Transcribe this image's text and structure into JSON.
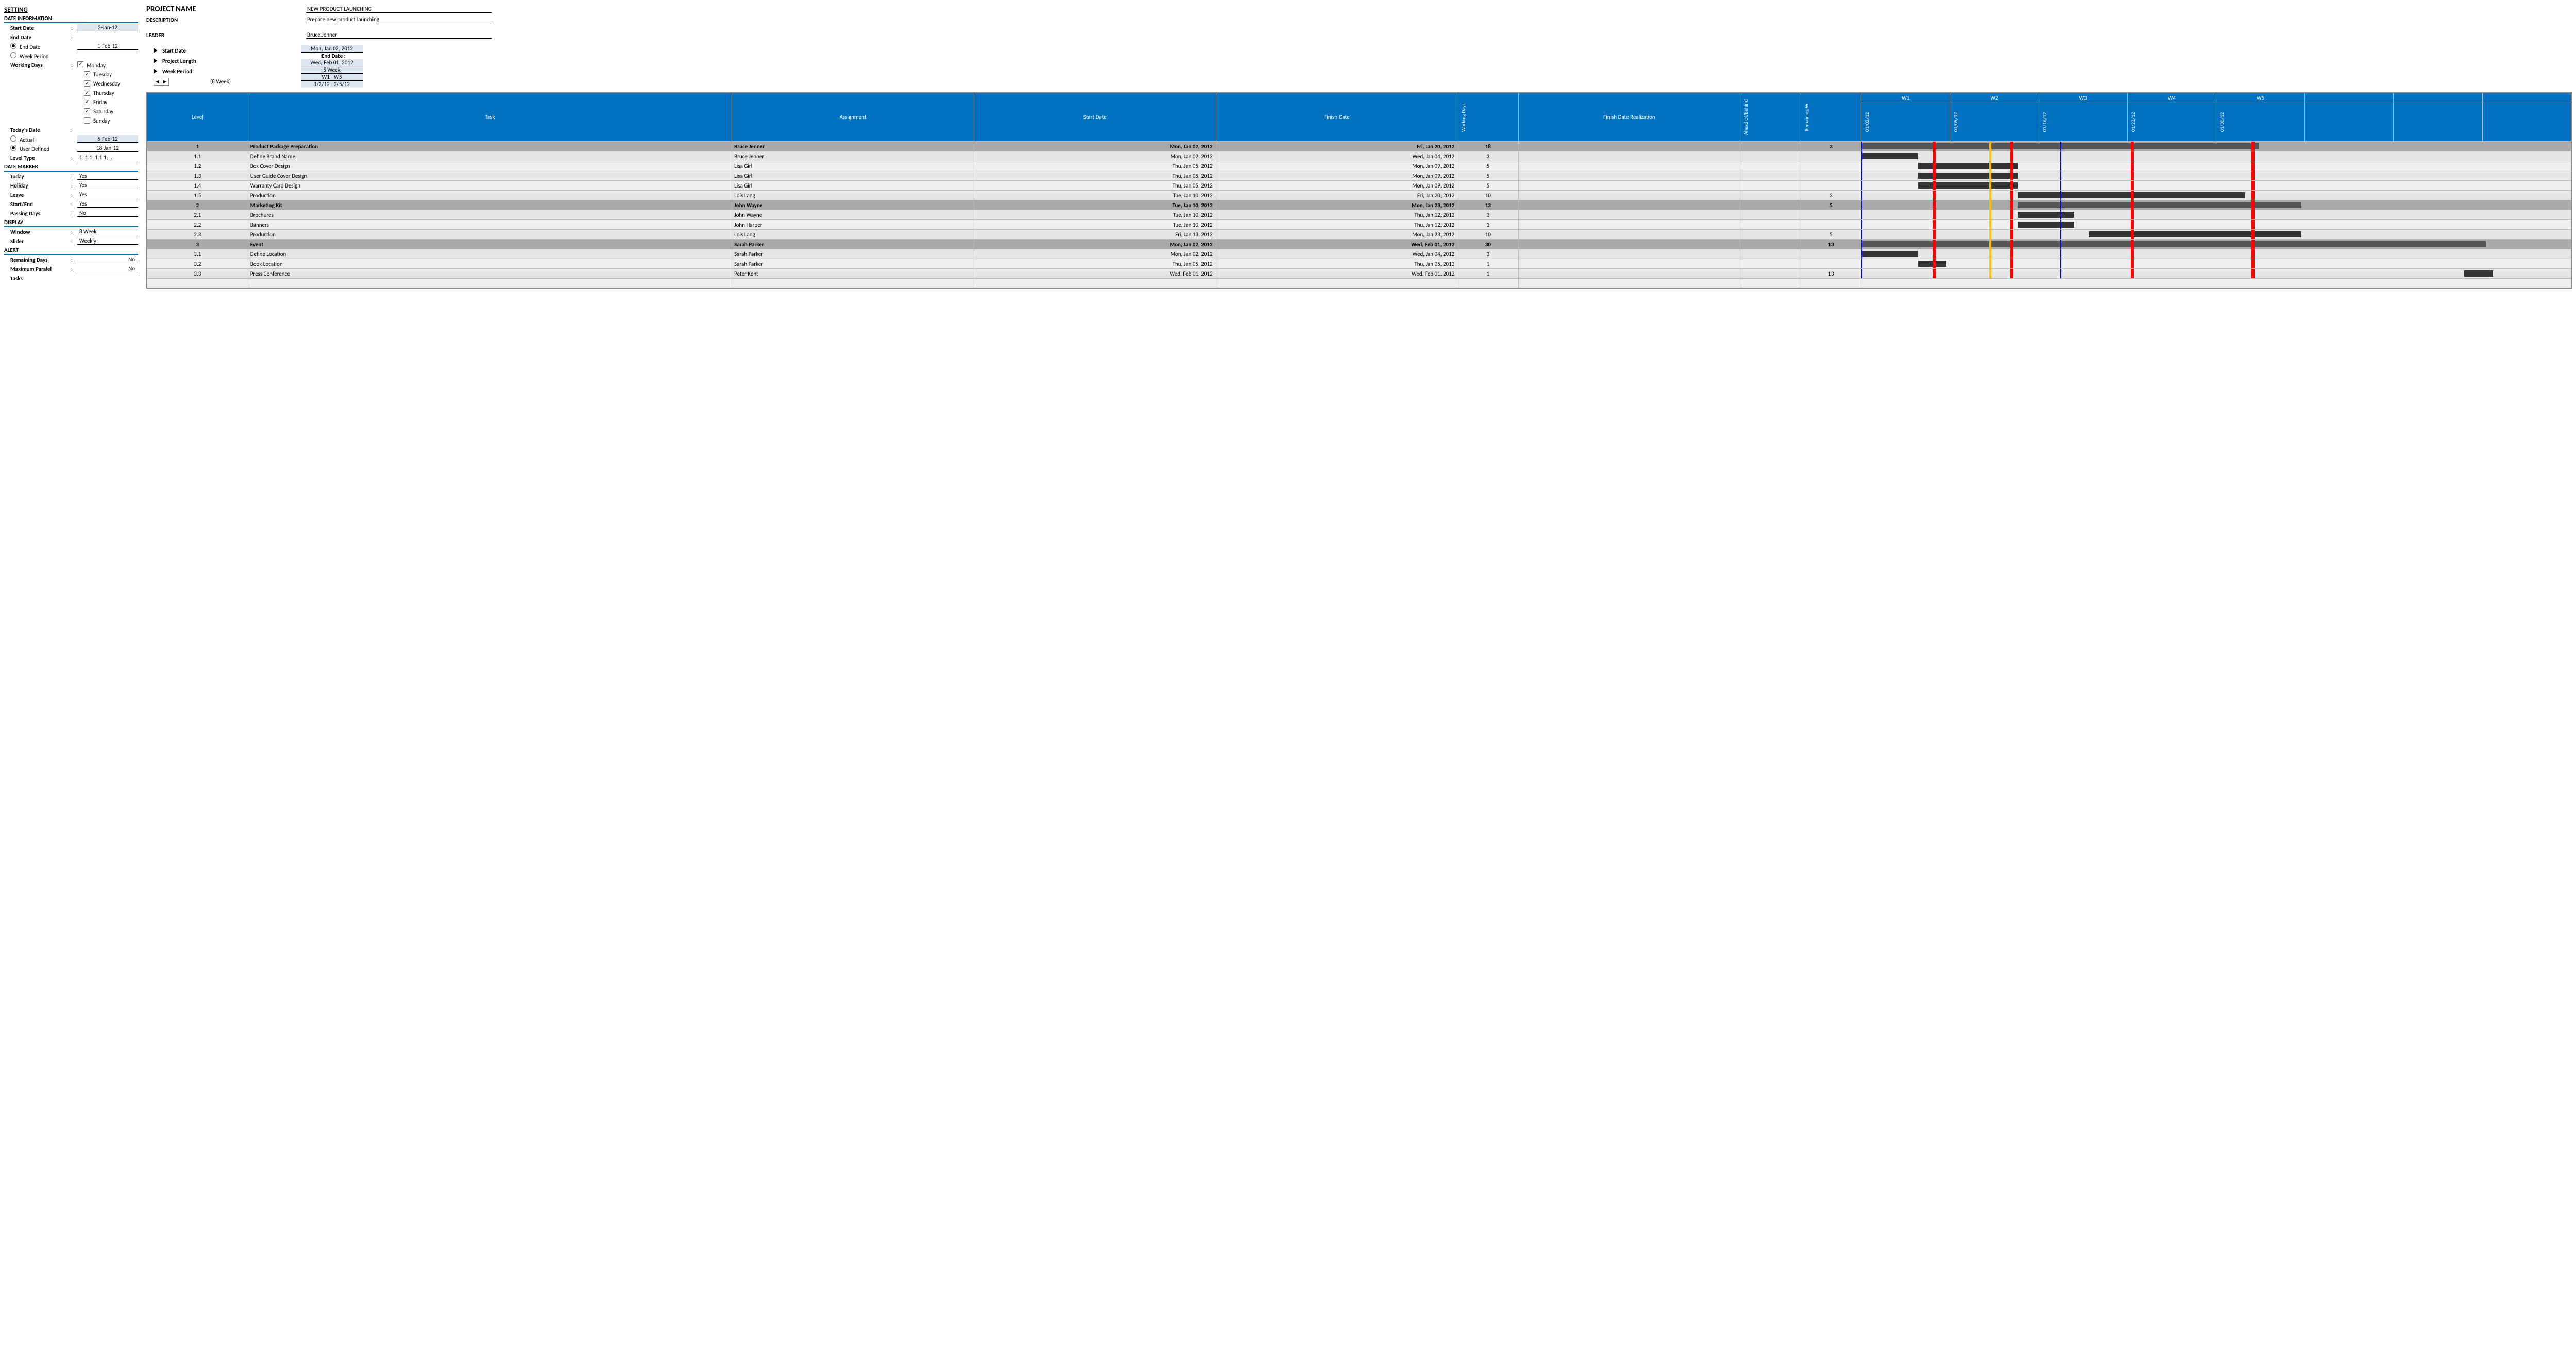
{
  "sidebar": {
    "setting": "SETTING",
    "date_info": "DATE INFORMATION",
    "start_date_label": "Start Date",
    "start_date": "2-Jan-12",
    "end_date_label": "End Date",
    "opt_end_date": "End Date",
    "opt_end_date_val": "1-Feb-12",
    "opt_week_period": "Week Period",
    "working_days_label": "Working Days",
    "days": [
      {
        "label": "Monday",
        "checked": true
      },
      {
        "label": "Tuesday",
        "checked": true
      },
      {
        "label": "Wednesday",
        "checked": true
      },
      {
        "label": "Thursday",
        "checked": true
      },
      {
        "label": "Friday",
        "checked": true
      },
      {
        "label": "Saturday",
        "checked": true
      },
      {
        "label": "Sunday",
        "checked": false
      }
    ],
    "today_label": "Today's Date",
    "opt_actual": "Actual",
    "opt_actual_val": "6-Feb-12",
    "opt_user": "User Defined",
    "opt_user_val": "18-Jan-12",
    "level_type_label": "Level Type",
    "level_type_val": "1; 1.1; 1.1.1; ..",
    "date_marker": "DATE MARKER",
    "marker_today": "Today",
    "marker_today_val": "Yes",
    "marker_holiday": "Holiday",
    "marker_holiday_val": "Yes",
    "marker_leave": "Leave",
    "marker_leave_val": "Yes",
    "marker_se": "Start/End",
    "marker_se_val": "Yes",
    "marker_pd": "Passing Days",
    "marker_pd_val": "No",
    "display": "DISPLAY",
    "window_label": "Window",
    "window_val": "8 Week",
    "slider_label": "Slider",
    "slider_val": "Weekly",
    "alert": "ALERT",
    "remaining_label": "Remaining Days",
    "remaining_val": "No",
    "maxpar_label": "Maximum Paralel",
    "maxpar_val": "No",
    "tasks_label": "Tasks"
  },
  "header": {
    "pname_label": "PROJECT NAME",
    "pname_val": "NEW PRODUCT LAUNCHING",
    "desc_label": "DESCRIPTION",
    "desc_val": "Prepare new product launching",
    "leader_label": "LEADER",
    "leader_val": "Bruce Jenner",
    "start_label": "Start Date",
    "start_val": "Mon, Jan 02, 2012",
    "end_label": "End Date :",
    "end_val": "Wed, Feb 01, 2012",
    "plen_label": "Project Length",
    "plen_val": "5 Week",
    "wp_label": "Week Period",
    "wp_val": "W1 - W5",
    "win_label": "(8 Week)",
    "win_val": "1/2/12 - 2/5/12"
  },
  "table": {
    "headers": {
      "level": "Level",
      "task": "Task",
      "assignment": "Assignment",
      "start": "Start Date",
      "finish": "Finish Date",
      "wd": "Working Days",
      "fr": "Finish Date Realization",
      "ab": "Ahead of/Behind",
      "rw": "Remaining W"
    },
    "weeks": [
      "W1",
      "W2",
      "W3",
      "W4",
      "W5",
      "",
      "",
      ""
    ],
    "weekdates": [
      "01/02/12",
      "01/09/12",
      "01/16/12",
      "01/23/12",
      "01/30/12",
      "",
      "",
      ""
    ],
    "rows": [
      {
        "level": "1",
        "task": "Product Package Preparation",
        "assign": "Bruce Jenner",
        "start": "Mon, Jan 02, 2012",
        "finish": "Fri, Jan 20, 2012",
        "wd": "18",
        "rw": "3",
        "parent": true,
        "bar": [
          0,
          56
        ]
      },
      {
        "level": "1.1",
        "task": "Define Brand Name",
        "assign": "Bruce Jenner",
        "start": "Mon, Jan 02, 2012",
        "finish": "Wed, Jan 04, 2012",
        "wd": "3",
        "rw": "",
        "parent": false,
        "bar": [
          0,
          8
        ]
      },
      {
        "level": "1.2",
        "task": "Box Cover Design",
        "assign": "Lisa Girl",
        "start": "Thu, Jan 05, 2012",
        "finish": "Mon, Jan 09, 2012",
        "wd": "5",
        "rw": "",
        "parent": false,
        "bar": [
          8,
          14
        ]
      },
      {
        "level": "1.3",
        "task": "User Guide Cover Design",
        "assign": "Lisa Girl",
        "start": "Thu, Jan 05, 2012",
        "finish": "Mon, Jan 09, 2012",
        "wd": "5",
        "rw": "",
        "parent": false,
        "bar": [
          8,
          14
        ]
      },
      {
        "level": "1.4",
        "task": "Warranty Card Design",
        "assign": "Lisa Girl",
        "start": "Thu, Jan 05, 2012",
        "finish": "Mon, Jan 09, 2012",
        "wd": "5",
        "rw": "",
        "parent": false,
        "bar": [
          8,
          14
        ]
      },
      {
        "level": "1.5",
        "task": "Production",
        "assign": "Lois Lang",
        "start": "Tue, Jan 10, 2012",
        "finish": "Fri, Jan 20, 2012",
        "wd": "10",
        "rw": "3",
        "parent": false,
        "bar": [
          22,
          32
        ]
      },
      {
        "level": "2",
        "task": "Marketing Kit",
        "assign": "John Wayne",
        "start": "Tue, Jan 10, 2012",
        "finish": "Mon, Jan 23, 2012",
        "wd": "13",
        "rw": "5",
        "parent": true,
        "bar": [
          22,
          40
        ]
      },
      {
        "level": "2.1",
        "task": "Brochures",
        "assign": "John Wayne",
        "start": "Tue, Jan 10, 2012",
        "finish": "Thu, Jan 12, 2012",
        "wd": "3",
        "rw": "",
        "parent": false,
        "bar": [
          22,
          8
        ]
      },
      {
        "level": "2.2",
        "task": "Banners",
        "assign": "John Harper",
        "start": "Tue, Jan 10, 2012",
        "finish": "Thu, Jan 12, 2012",
        "wd": "3",
        "rw": "",
        "parent": false,
        "bar": [
          22,
          8
        ]
      },
      {
        "level": "2.3",
        "task": "Production",
        "assign": "Lois Lang",
        "start": "Fri, Jan 13, 2012",
        "finish": "Mon, Jan 23, 2012",
        "wd": "10",
        "rw": "5",
        "parent": false,
        "bar": [
          32,
          30
        ]
      },
      {
        "level": "3",
        "task": "Event",
        "assign": "Sarah Parker",
        "start": "Mon, Jan 02, 2012",
        "finish": "Wed, Feb 01, 2012",
        "wd": "30",
        "rw": "13",
        "parent": true,
        "bar": [
          0,
          88
        ]
      },
      {
        "level": "3.1",
        "task": "Define Location",
        "assign": "Sarah Parker",
        "start": "Mon, Jan 02, 2012",
        "finish": "Wed, Jan 04, 2012",
        "wd": "3",
        "rw": "",
        "parent": false,
        "bar": [
          0,
          8
        ]
      },
      {
        "level": "3.2",
        "task": "Book Location",
        "assign": "Sarah Parker",
        "start": "Thu, Jan 05, 2012",
        "finish": "Thu, Jan 05, 2012",
        "wd": "1",
        "rw": "",
        "parent": false,
        "bar": [
          8,
          4
        ]
      },
      {
        "level": "3.3",
        "task": "Press Conference",
        "assign": "Peter Kent",
        "start": "Wed, Feb 01, 2012",
        "finish": "Wed, Feb 01, 2012",
        "wd": "1",
        "rw": "13",
        "parent": false,
        "bar": [
          85,
          4
        ]
      }
    ]
  }
}
